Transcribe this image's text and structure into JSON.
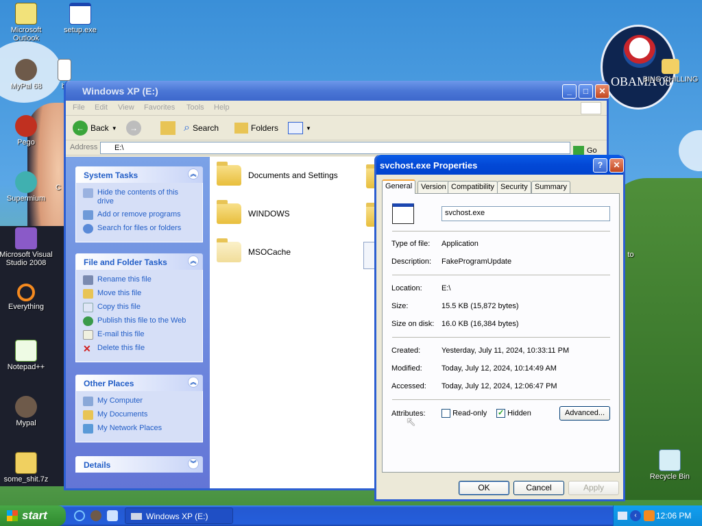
{
  "desktop": {
    "icons": [
      {
        "label": "Microsoft\nOutlook",
        "icon": "outlook-icon"
      },
      {
        "label": "setup.exe",
        "icon": "window-icon"
      },
      {
        "label": "MyPal 68",
        "icon": "mypal-icon"
      },
      {
        "label": "bi",
        "icon": "document-icon"
      },
      {
        "label": "Pego",
        "icon": "pego-icon"
      },
      {
        "label": "Supermium",
        "icon": "supermium-icon"
      },
      {
        "label": "C",
        "icon": "app-icon"
      },
      {
        "label": "Microsoft Visual\nStudio 2008",
        "icon": "visual-studio-icon"
      },
      {
        "label": "Everything",
        "icon": "everything-icon"
      },
      {
        "label": "Notepad++",
        "icon": "notepad-plus-icon"
      },
      {
        "label": "Mypal",
        "icon": "mypal-icon"
      },
      {
        "label": "some_shit.7z",
        "icon": "archive-icon"
      },
      {
        "label": "BING CHILLING",
        "icon": "folder-icon"
      },
      {
        "label": "Recycle Bin",
        "icon": "recycle-bin-icon"
      },
      {
        "label": "to",
        "icon": "app-icon"
      }
    ],
    "badge": {
      "text": "OBAMA'08"
    }
  },
  "explorer": {
    "title": "Windows XP (E:)",
    "menu": [
      "File",
      "Edit",
      "View",
      "Favorites",
      "Tools",
      "Help"
    ],
    "toolbar": {
      "back": "Back",
      "search": "Search",
      "folders": "Folders"
    },
    "address": {
      "label": "Address",
      "value": "E:\\",
      "go": "Go"
    },
    "system_tasks": {
      "title": "System Tasks",
      "items": [
        "Hide the contents of this drive",
        "Add or remove programs",
        "Search for files or folders"
      ]
    },
    "file_tasks": {
      "title": "File and Folder Tasks",
      "items": [
        "Rename this file",
        "Move this file",
        "Copy this file",
        "Publish this file to the Web",
        "E-mail this file",
        "Delete this file"
      ]
    },
    "other_places": {
      "title": "Other Places",
      "items": [
        "My Computer",
        "My Documents",
        "My Network Places"
      ]
    },
    "details": {
      "title": "Details"
    },
    "folders": [
      "Documents and Settings",
      "WINDOWS",
      "MSOCache"
    ]
  },
  "dialog": {
    "title": "svchost.exe Properties",
    "tabs": [
      "General",
      "Version",
      "Compatibility",
      "Security",
      "Summary"
    ],
    "filename": "svchost.exe",
    "labels": {
      "type": "Type of file:",
      "description": "Description:",
      "location": "Location:",
      "size": "Size:",
      "size_on_disk": "Size on disk:",
      "created": "Created:",
      "modified": "Modified:",
      "accessed": "Accessed:",
      "attributes": "Attributes:"
    },
    "values": {
      "type": "Application",
      "description": "FakeProgramUpdate",
      "location": "E:\\",
      "size": "15.5 KB (15,872 bytes)",
      "size_on_disk": "16.0 KB (16,384 bytes)",
      "created": "Yesterday, July 11, 2024, 10:33:11 PM",
      "modified": "Today, July 12, 2024, 10:14:49 AM",
      "accessed": "Today, July 12, 2024, 12:06:47 PM"
    },
    "attributes": {
      "readonly": "Read-only",
      "readonly_checked": false,
      "hidden": "Hidden",
      "hidden_checked": true,
      "advanced": "Advanced..."
    },
    "buttons": {
      "ok": "OK",
      "cancel": "Cancel",
      "apply": "Apply"
    }
  },
  "taskbar": {
    "start": "start",
    "window": "Windows XP (E:)",
    "clock": "12:06 PM"
  },
  "colors": {
    "xp_blue": "#0a5de7",
    "task_link": "#215dc6",
    "start_green": "#2f8a2e"
  }
}
